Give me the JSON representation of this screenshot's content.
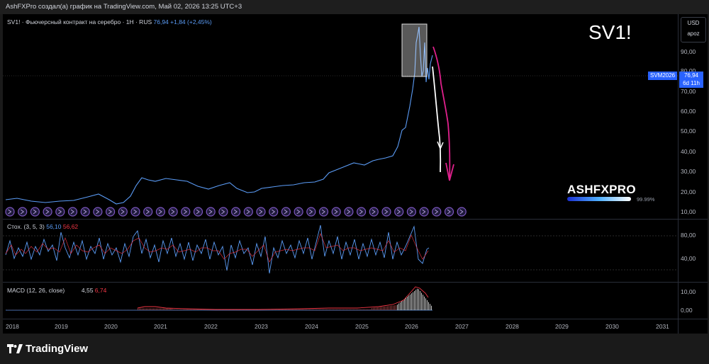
{
  "credit_line": "AshFXPro создал(а) график на TradingView.com, Май 02, 2026 13:25 UTC+3",
  "main_legend": {
    "symbol": "SV1! · Фьючерсный контракт на серебро · 1H · RUS",
    "last": "76,94",
    "change": "+1,84 (+2,45%)"
  },
  "big_label": "SV1!",
  "currency": {
    "code": "USD",
    "mode": "apoz"
  },
  "price_axis": [
    "90,00",
    "80,00",
    "70,00",
    "60,00",
    "50,00",
    "40,00",
    "30,00",
    "20,00",
    "10,00"
  ],
  "price_tag": {
    "symbol": "SVM2026",
    "value": "76,94",
    "countdown": "6d 11h"
  },
  "logo": {
    "text": "ASHFXPRO",
    "progress_percent": 99.99,
    "progress_label": "99.99%"
  },
  "stoch": {
    "label": "Стох. (3, 5, 3)",
    "k": "56,10",
    "d": "56,62",
    "axis": [
      "80,00",
      "40,00"
    ]
  },
  "macd": {
    "label": "MACD (12, 26, close)",
    "v1": "4,55",
    "v2": "6,74",
    "axis": [
      "10,00",
      "0,00"
    ]
  },
  "years": [
    "2018",
    "2019",
    "2020",
    "2021",
    "2022",
    "2023",
    "2024",
    "2025",
    "2026",
    "2027",
    "2028",
    "2029",
    "2030",
    "2031"
  ],
  "footer": {
    "brand": "TradingView"
  },
  "colors": {
    "price_line": "#5b9cf6",
    "forecast_pink": "#e0208c",
    "forecast_white": "#ffffff",
    "signal": "#f23645"
  }
}
